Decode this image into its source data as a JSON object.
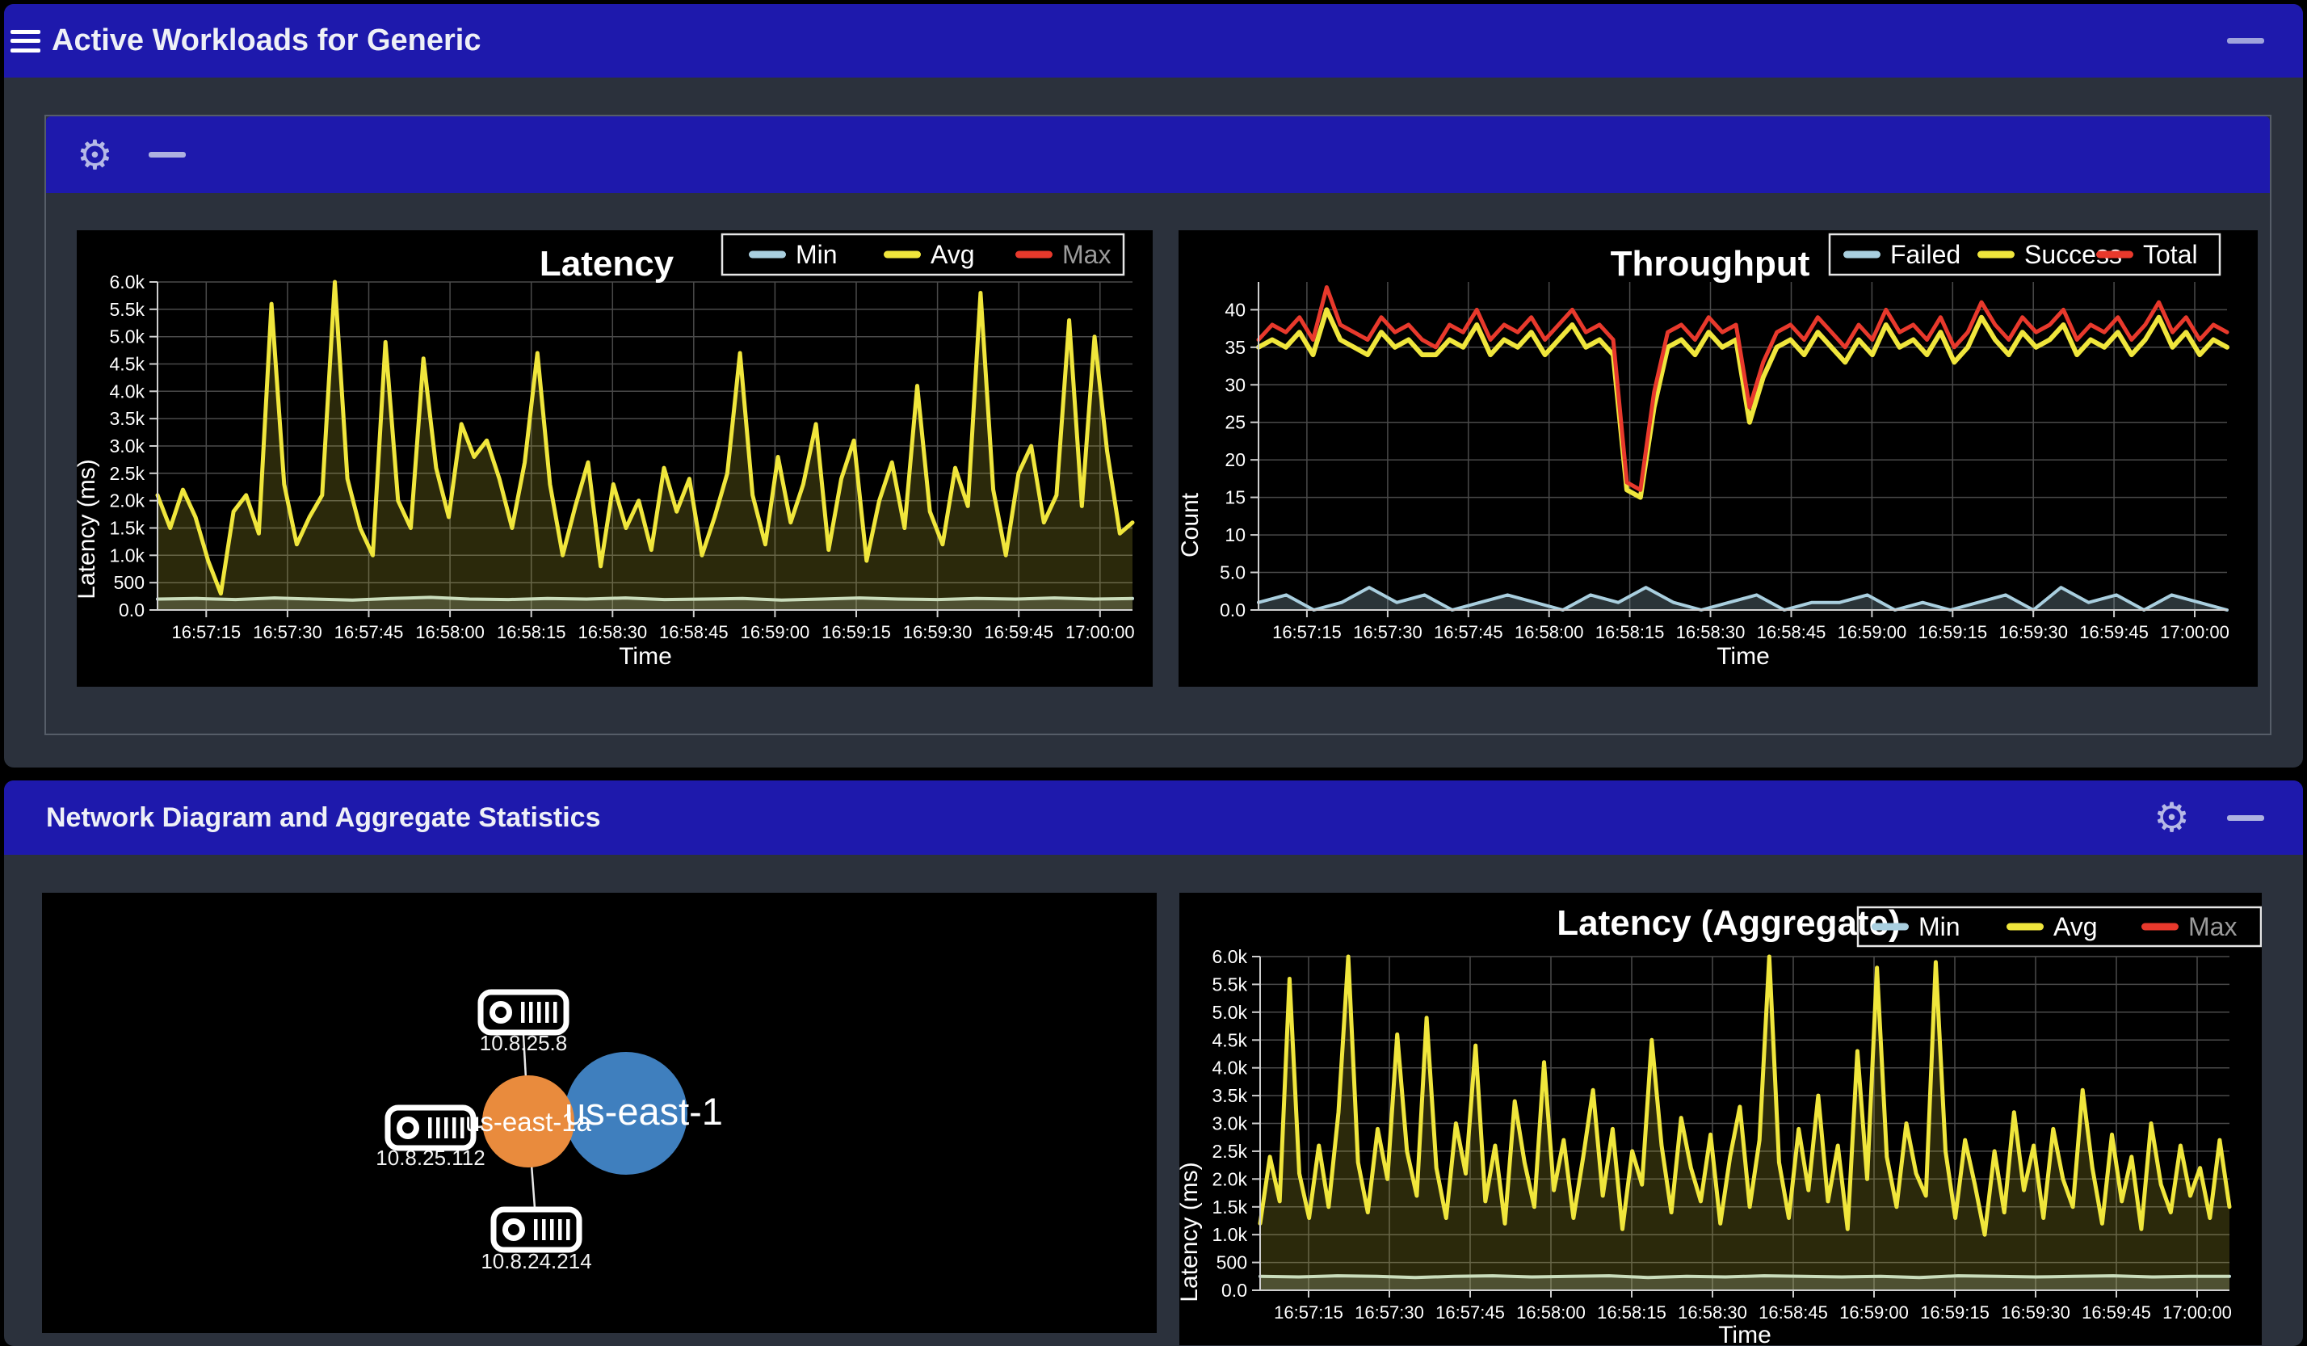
{
  "titlebar": {
    "title": "Active Workloads for Generic",
    "menu_icon": "hamburger-icon",
    "minimize_icon": "minimize-icon"
  },
  "workloads_panel": {
    "gear_icon": "gear-icon",
    "minimize_icon": "minimize-icon",
    "gear_glyph": "⚙"
  },
  "section2": {
    "title": "Network Diagram and Aggregate Statistics",
    "gear_icon": "gear-icon",
    "minimize_icon": "minimize-icon",
    "gear_glyph": "⚙"
  },
  "colors": {
    "header_blue": "#1e19ac",
    "panel_body": "#2b313c",
    "canvas": "#000000",
    "accent_yellow": "#f0e63c",
    "accent_red": "#e8392c",
    "accent_lightblue": "#a9cfdf",
    "min_line": "#c2dcd8",
    "grid": "#4a4a4a",
    "axis": "#cfcfcf",
    "zone_orange": "#e98b3d",
    "region_blue": "#3f7fbe",
    "disabled_text": "#9a9a9a"
  },
  "diagram": {
    "zone": {
      "label": "us-east-1a",
      "color": "#e98b3d"
    },
    "region": {
      "label": "us-east-1",
      "color": "#3f7fbe"
    },
    "nodes": [
      {
        "ip": "10.8.25.8"
      },
      {
        "ip": "10.8.25.112"
      },
      {
        "ip": "10.8.24.214"
      }
    ]
  },
  "chart_data": [
    {
      "id": "latency",
      "type": "line",
      "title": "Latency",
      "xlabel": "Time",
      "ylabel": "Latency (ms)",
      "ylim": [
        0,
        6000
      ],
      "y_max": 6000,
      "grid": true,
      "legend_position": "top-right",
      "x_ticks": [
        "16:57:15",
        "16:57:30",
        "16:57:45",
        "16:58:00",
        "16:58:15",
        "16:58:30",
        "16:58:45",
        "16:59:00",
        "16:59:15",
        "16:59:30",
        "16:59:45",
        "17:00:00"
      ],
      "y_tick_labels": [
        "0.0",
        "500",
        "1.0k",
        "1.5k",
        "2.0k",
        "2.5k",
        "3.0k",
        "3.5k",
        "4.0k",
        "4.5k",
        "5.0k",
        "5.5k",
        "6.0k"
      ],
      "y_tick_values": [
        0,
        500,
        1000,
        1500,
        2000,
        2500,
        3000,
        3500,
        4000,
        4500,
        5000,
        5500,
        6000
      ],
      "legend": [
        {
          "label": "Min",
          "color": "#a9cfdf",
          "active": true
        },
        {
          "label": "Avg",
          "color": "#f0e63c",
          "active": true
        },
        {
          "label": "Max",
          "color": "#e8392c",
          "active": false
        }
      ],
      "series": [
        {
          "name": "Min",
          "color": "#c2dcd8",
          "width": 4,
          "fill": true,
          "fill_opacity": 0.22,
          "values": [
            200,
            210,
            190,
            220,
            200,
            180,
            210,
            230,
            200,
            190,
            210,
            200,
            220,
            190,
            200,
            210,
            180,
            200,
            220,
            200,
            190,
            210,
            200,
            220,
            200,
            210
          ]
        },
        {
          "name": "Avg",
          "color": "#f0e63c",
          "width": 5,
          "fill": true,
          "fill_opacity": 0.18,
          "values": [
            2100,
            1500,
            2200,
            1700,
            900,
            300,
            1800,
            2100,
            1400,
            5600,
            2300,
            1200,
            1700,
            2100,
            6000,
            2400,
            1500,
            1000,
            4900,
            2000,
            1500,
            4600,
            2600,
            1700,
            3400,
            2800,
            3100,
            2400,
            1500,
            2700,
            4700,
            2300,
            1000,
            1900,
            2700,
            800,
            2300,
            1500,
            2000,
            1100,
            2600,
            1800,
            2400,
            1000,
            1700,
            2500,
            4700,
            2100,
            1200,
            2800,
            1600,
            2300,
            3400,
            1100,
            2400,
            3100,
            900,
            2000,
            2700,
            1500,
            4100,
            1800,
            1200,
            2600,
            1900,
            5800,
            2200,
            1000,
            2500,
            3000,
            1600,
            2100,
            5300,
            1900,
            5000,
            2900,
            1400,
            1600
          ]
        }
      ]
    },
    {
      "id": "throughput",
      "type": "line",
      "title": "Throughput",
      "xlabel": "Time",
      "ylabel": "Count",
      "ylim": [
        0,
        43.7
      ],
      "y_max": 43.7,
      "grid": true,
      "legend_position": "top-right",
      "x_ticks": [
        "16:57:15",
        "16:57:30",
        "16:57:45",
        "16:58:00",
        "16:58:15",
        "16:58:30",
        "16:58:45",
        "16:59:00",
        "16:59:15",
        "16:59:30",
        "16:59:45",
        "17:00:00"
      ],
      "y_tick_labels": [
        "0.0",
        "5.0",
        "10",
        "15",
        "20",
        "25",
        "30",
        "35",
        "40"
      ],
      "y_tick_values": [
        0,
        5,
        10,
        15,
        20,
        25,
        30,
        35,
        40
      ],
      "legend": [
        {
          "label": "Failed",
          "color": "#a9cfdf",
          "active": true
        },
        {
          "label": "Success",
          "color": "#f0e63c",
          "active": true
        },
        {
          "label": "Total",
          "color": "#e8392c",
          "active": true
        }
      ],
      "series": [
        {
          "name": "Failed",
          "color": "#a9cfdf",
          "width": 4,
          "fill": true,
          "fill_opacity": 0.25,
          "values": [
            1,
            2,
            0,
            1,
            3,
            1,
            2,
            0,
            1,
            2,
            1,
            0,
            2,
            1,
            3,
            1,
            0,
            1,
            2,
            0,
            1,
            1,
            2,
            0,
            1,
            0,
            1,
            2,
            0,
            3,
            1,
            2,
            0,
            2,
            1,
            0
          ]
        },
        {
          "name": "Success",
          "color": "#f0e63c",
          "width": 6,
          "fill": false,
          "fill_opacity": 0,
          "values": [
            35,
            36,
            35,
            37,
            34,
            40,
            36,
            35,
            34,
            37,
            35,
            36,
            34,
            34,
            36,
            35,
            38,
            34,
            36,
            35,
            37,
            34,
            36,
            38,
            35,
            36,
            34,
            16,
            15,
            27,
            35,
            36,
            34,
            37,
            35,
            36,
            25,
            31,
            35,
            36,
            34,
            37,
            35,
            33,
            36,
            34,
            38,
            35,
            36,
            34,
            37,
            33,
            35,
            39,
            36,
            34,
            37,
            35,
            36,
            38,
            34,
            36,
            35,
            37,
            34,
            36,
            39,
            35,
            37,
            34,
            36,
            35
          ]
        },
        {
          "name": "Total",
          "color": "#e8392c",
          "width": 5,
          "fill": false,
          "fill_opacity": 0,
          "values": [
            36,
            38,
            37,
            39,
            36,
            43,
            38,
            37,
            36,
            39,
            37,
            38,
            36,
            35,
            38,
            37,
            40,
            36,
            38,
            37,
            39,
            36,
            38,
            40,
            37,
            38,
            36,
            17,
            16,
            29,
            37,
            38,
            36,
            39,
            37,
            38,
            27,
            33,
            37,
            38,
            36,
            39,
            37,
            35,
            38,
            36,
            40,
            37,
            38,
            36,
            39,
            35,
            37,
            41,
            38,
            36,
            39,
            37,
            38,
            40,
            36,
            38,
            37,
            39,
            36,
            38,
            41,
            37,
            39,
            36,
            38,
            37
          ]
        }
      ]
    },
    {
      "id": "aggregate",
      "type": "line",
      "title": "Latency (Aggregate)",
      "xlabel": "Time",
      "ylabel": "Latency (ms)",
      "ylim": [
        0,
        6000
      ],
      "y_max": 6000,
      "grid": true,
      "legend_position": "top-right",
      "x_ticks": [
        "16:57:15",
        "16:57:30",
        "16:57:45",
        "16:58:00",
        "16:58:15",
        "16:58:30",
        "16:58:45",
        "16:59:00",
        "16:59:15",
        "16:59:30",
        "16:59:45",
        "17:00:00"
      ],
      "y_tick_labels": [
        "0.0",
        "500",
        "1.0k",
        "1.5k",
        "2.0k",
        "2.5k",
        "3.0k",
        "3.5k",
        "4.0k",
        "4.5k",
        "5.0k",
        "5.5k",
        "6.0k"
      ],
      "y_tick_values": [
        0,
        500,
        1000,
        1500,
        2000,
        2500,
        3000,
        3500,
        4000,
        4500,
        5000,
        5500,
        6000
      ],
      "legend": [
        {
          "label": "Min",
          "color": "#a9cfdf",
          "active": true
        },
        {
          "label": "Avg",
          "color": "#f0e63c",
          "active": true
        },
        {
          "label": "Max",
          "color": "#e8392c",
          "active": false
        }
      ],
      "series": [
        {
          "name": "Min",
          "color": "#c2dcd8",
          "width": 4,
          "fill": true,
          "fill_opacity": 0.22,
          "values": [
            250,
            240,
            260,
            250,
            230,
            250,
            260,
            240,
            250,
            260,
            230,
            250,
            240,
            260,
            250,
            240,
            250,
            230,
            260,
            250,
            240,
            250,
            260,
            240,
            250,
            250
          ]
        },
        {
          "name": "Avg",
          "color": "#f0e63c",
          "width": 5,
          "fill": true,
          "fill_opacity": 0.18,
          "values": [
            1200,
            2400,
            1600,
            5600,
            2100,
            1300,
            2600,
            1500,
            3200,
            6000,
            2300,
            1400,
            2900,
            2000,
            4600,
            2500,
            1700,
            4900,
            2200,
            1300,
            3000,
            2100,
            4400,
            1600,
            2600,
            1200,
            3400,
            2300,
            1500,
            4100,
            1800,
            2700,
            1300,
            2400,
            3600,
            1700,
            2900,
            1100,
            2500,
            1900,
            4500,
            2600,
            1400,
            3100,
            2200,
            1600,
            2800,
            1200,
            2400,
            3300,
            1500,
            2700,
            6100,
            2300,
            1300,
            2900,
            1800,
            3500,
            1600,
            2600,
            1100,
            4300,
            2000,
            5800,
            2400,
            1500,
            3000,
            2100,
            1700,
            5900,
            2500,
            1300,
            2700,
            1900,
            1000,
            2500,
            1400,
            3200,
            1800,
            2600,
            1300,
            2900,
            2000,
            1500,
            3600,
            2200,
            1200,
            2800,
            1600,
            2400,
            1100,
            3000,
            1900,
            1400,
            2600,
            1700,
            2200,
            1300,
            2700,
            1500
          ]
        }
      ]
    }
  ]
}
